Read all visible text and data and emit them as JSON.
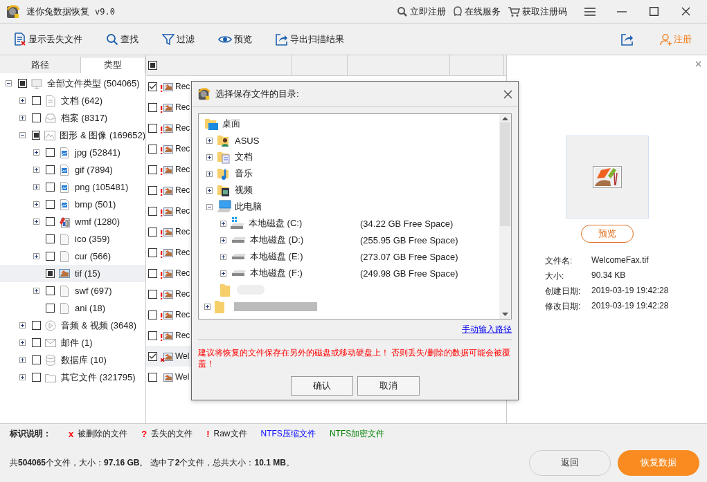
{
  "window": {
    "title": "迷你兔数据恢复",
    "version": "v9.0",
    "links": [
      {
        "kind": "search",
        "label": "立即注册"
      },
      {
        "kind": "chat",
        "label": "在线服务"
      },
      {
        "kind": "cart",
        "label": "获取注册码"
      }
    ]
  },
  "toolbar": {
    "items": [
      {
        "kind": "lost",
        "label": "显示丢失文件"
      },
      {
        "kind": "search",
        "label": "查找"
      },
      {
        "kind": "filter",
        "label": "过滤"
      },
      {
        "kind": "eye",
        "label": "预览"
      },
      {
        "kind": "export",
        "label": "导出扫描结果"
      }
    ],
    "register": "注册"
  },
  "tabs": [
    {
      "label": "路径",
      "selected": false
    },
    {
      "label": "类型",
      "selected": true
    }
  ],
  "tree": [
    {
      "label": "全部文件类型 (504065)",
      "kind": "monitor",
      "checked": true,
      "expanded": true,
      "selected": false,
      "children": [
        {
          "label": "文档 (642)",
          "kind": "doc",
          "checked": false,
          "expanded": false,
          "selected": false
        },
        {
          "label": "档案 (8317)",
          "kind": "archive",
          "checked": false,
          "expanded": false,
          "selected": false
        },
        {
          "label": "图形 & 图像 (169652)",
          "kind": "image",
          "checked": true,
          "expanded": true,
          "selected": false,
          "children": [
            {
              "label": "jpg (52841)",
              "kind": "picfile",
              "checked": false,
              "expanded": false,
              "selected": false
            },
            {
              "label": "gif (7894)",
              "kind": "picfile",
              "checked": false,
              "expanded": false,
              "selected": false
            },
            {
              "label": "png (105481)",
              "kind": "picfile",
              "checked": false,
              "expanded": false,
              "selected": false
            },
            {
              "label": "bmp (501)",
              "kind": "picfile",
              "checked": false,
              "expanded": false,
              "selected": false
            },
            {
              "label": "wmf (1280)",
              "kind": "wmf",
              "checked": false,
              "expanded": false,
              "selected": false
            },
            {
              "label": "ico (359)",
              "kind": "blank",
              "checked": false,
              "selected": false
            },
            {
              "label": "cur (566)",
              "kind": "blank",
              "checked": false,
              "expanded": false,
              "selected": false
            },
            {
              "label": "tif (15)",
              "kind": "tif",
              "checked": true,
              "selected": true
            },
            {
              "label": "swf (697)",
              "kind": "blank",
              "checked": false,
              "expanded": false,
              "selected": false
            },
            {
              "label": "ani (18)",
              "kind": "blank",
              "checked": false,
              "selected": false
            }
          ]
        },
        {
          "label": "音频 & 视频 (3648)",
          "kind": "play",
          "checked": false,
          "expanded": false,
          "selected": false
        },
        {
          "label": "邮件 (1)",
          "kind": "mail",
          "checked": false,
          "expanded": false,
          "selected": false
        },
        {
          "label": "数据库 (10)",
          "kind": "db",
          "checked": false,
          "expanded": false,
          "selected": false
        },
        {
          "label": "其它文件 (321795)",
          "kind": "folder",
          "checked": false,
          "expanded": false,
          "selected": false
        }
      ]
    }
  ],
  "table": {
    "all_checked": true,
    "rows": [
      {
        "name": "Rec",
        "kind": "raw",
        "checked": true,
        "selected": false
      },
      {
        "name": "Rec",
        "kind": "raw",
        "checked": false,
        "selected": false
      },
      {
        "name": "Rec",
        "kind": "raw",
        "checked": false,
        "selected": false
      },
      {
        "name": "Rec",
        "kind": "raw",
        "checked": false,
        "selected": false
      },
      {
        "name": "Rec",
        "kind": "raw",
        "checked": false,
        "selected": false
      },
      {
        "name": "Rec",
        "kind": "raw",
        "checked": false,
        "selected": false
      },
      {
        "name": "Rec",
        "kind": "raw",
        "checked": false,
        "selected": false
      },
      {
        "name": "Rec",
        "kind": "raw",
        "checked": false,
        "selected": false
      },
      {
        "name": "Rec",
        "kind": "raw",
        "checked": false,
        "selected": false
      },
      {
        "name": "Rec",
        "kind": "raw",
        "checked": false,
        "selected": false
      },
      {
        "name": "Rec",
        "kind": "raw",
        "checked": false,
        "selected": false
      },
      {
        "name": "Rec",
        "kind": "raw",
        "checked": false,
        "selected": false
      },
      {
        "name": "Rec",
        "kind": "raw",
        "checked": false,
        "selected": false
      },
      {
        "name": "Wel",
        "kind": "deleted",
        "checked": true,
        "selected": true
      },
      {
        "name": "Wel",
        "kind": "normal",
        "checked": false,
        "selected": false
      }
    ]
  },
  "preview": {
    "button": "预览",
    "info": [
      {
        "label": "文件名:",
        "value": "WelcomeFax.tif"
      },
      {
        "label": "大小:",
        "value": "90.34 KB"
      },
      {
        "label": "创建日期:",
        "value": "2019-03-19 19:42:28"
      },
      {
        "label": "修改日期:",
        "value": "2019-03-19 19:42:28"
      }
    ]
  },
  "dialog": {
    "title": "选择保存文件的目录:",
    "tree": [
      {
        "label": "桌面",
        "kind": "desktop",
        "children": [
          {
            "label": "ASUS",
            "kind": "user",
            "expanded": false
          },
          {
            "label": "文档",
            "kind": "docs",
            "expanded": false
          },
          {
            "label": "音乐",
            "kind": "music",
            "expanded": false
          },
          {
            "label": "视频",
            "kind": "video",
            "expanded": false
          },
          {
            "label": "此电脑",
            "kind": "pc",
            "expanded": true,
            "children": [
              {
                "label": "本地磁盘 (C:)",
                "kind": "windrive",
                "free": "(34.22 GB Free Space)",
                "expanded": false
              },
              {
                "label": "本地磁盘 (D:)",
                "kind": "drive",
                "free": "(255.95 GB Free Space)",
                "expanded": false
              },
              {
                "label": "本地磁盘 (E:)",
                "kind": "drive",
                "free": "(273.07 GB Free Space)",
                "expanded": false
              },
              {
                "label": "本地磁盘 (F:)",
                "kind": "drive",
                "free": "(249.98 GB Free Space)",
                "expanded": false
              }
            ]
          }
        ]
      }
    ],
    "link": "手动输入路径",
    "warning": "建议将恢复的文件保存在另外的磁盘或移动硬盘上！ 否则丢失/删除的数据可能会被覆盖！",
    "buttons": [
      "确认",
      "取消"
    ]
  },
  "legend": {
    "title": "标识说明：",
    "items": [
      {
        "marker": "x",
        "label": "被删除的文件",
        "color": "#ff0000"
      },
      {
        "marker": "?",
        "label": "丢失的文件",
        "color": "#ff0000"
      },
      {
        "marker": "!",
        "label": "Raw文件",
        "color": "#ff0000"
      },
      {
        "label": "NTFS压缩文件",
        "color": "#0000ff"
      },
      {
        "label": "NTFS加密文件",
        "color": "#008000"
      }
    ]
  },
  "status": {
    "text": "共**504065**个文件，大小：**97.16 GB**。 选中了**2**个文件，总共大小：**10.1 MB**。",
    "buttons": [
      {
        "kind": "secondary",
        "label": "返回"
      },
      {
        "kind": "primary",
        "label": "恢复数据"
      }
    ]
  }
}
